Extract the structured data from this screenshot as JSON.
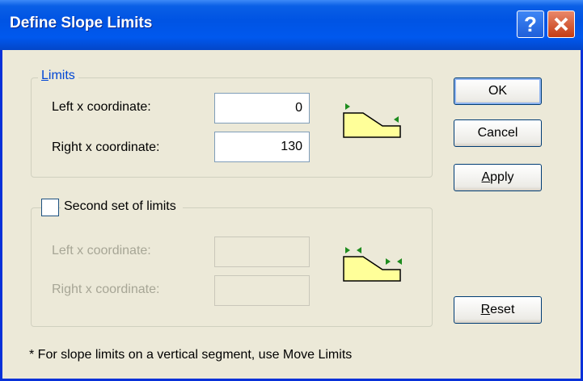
{
  "window": {
    "title": "Define Slope Limits"
  },
  "limits": {
    "legend": "Limits",
    "left_label": "Left x coordinate:",
    "left_value": "0",
    "right_label": "Right x coordinate:",
    "right_value": "130"
  },
  "second_limits": {
    "checkbox_label": "Second set of limits",
    "checked": false,
    "left_label": "Left x coordinate:",
    "left_value": "",
    "right_label": "Right x coordinate:",
    "right_value": ""
  },
  "buttons": {
    "ok": "OK",
    "cancel": "Cancel",
    "apply": "Apply",
    "reset": "Reset"
  },
  "note": "* For slope limits on a vertical segment, use Move Limits",
  "colors": {
    "titlebar": "#0054e3",
    "dialog_bg": "#ece9d8",
    "slope_fill": "#ffff99",
    "marker": "#1e8c1e"
  }
}
